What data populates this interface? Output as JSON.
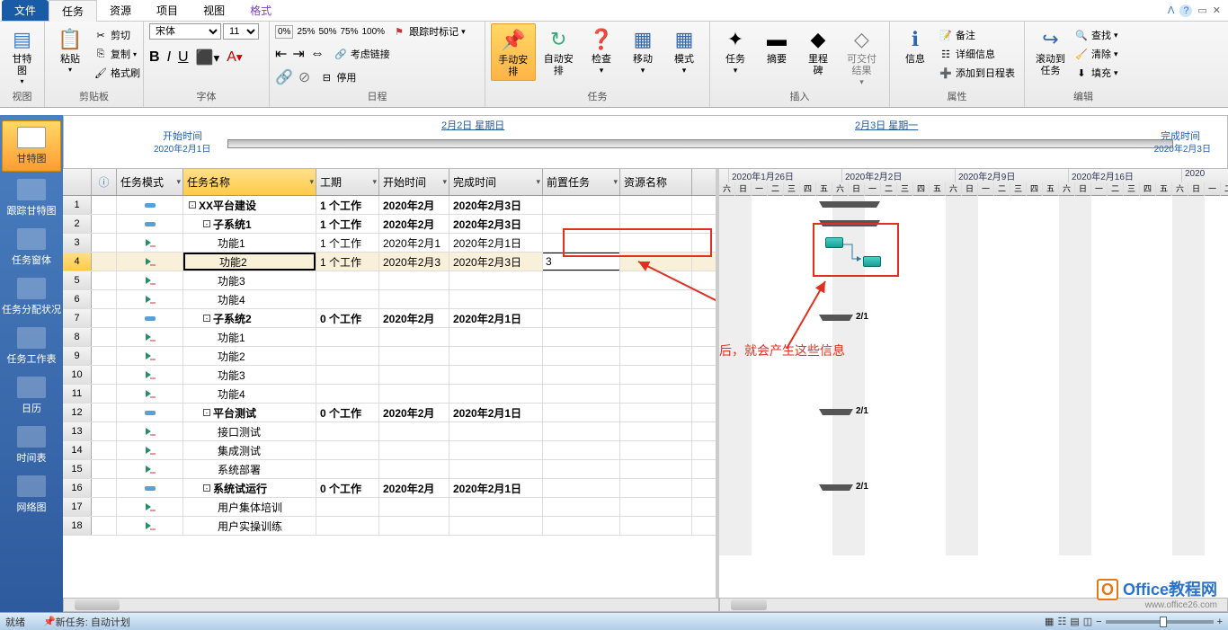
{
  "tabs": [
    "文件",
    "任务",
    "资源",
    "项目",
    "视图",
    "格式"
  ],
  "ribbon": {
    "view_label": "视图",
    "gantt_btn": "甘特图",
    "clipboard_label": "剪贴板",
    "paste": "粘贴",
    "cut": "剪切",
    "copy": "复制",
    "format_painter": "格式刷",
    "font_label": "字体",
    "font_name": "宋体",
    "font_size": "11",
    "schedule_label": "日程",
    "track_mark": "跟踪时标记",
    "respect_links": "考虑链接",
    "disable": "停用",
    "tasks_label": "任务",
    "manual": "手动安排",
    "auto": "自动安排",
    "inspect": "检查",
    "move": "移动",
    "mode": "模式",
    "insert_label": "插入",
    "task_btn": "任务",
    "summary_btn": "摘要",
    "milestone_btn": "里程碑",
    "deliverable_btn": "可交付结果",
    "properties_label": "属性",
    "info_btn": "信息",
    "notes": "备注",
    "details": "详细信息",
    "add_timeline": "添加到日程表",
    "editing_label": "编辑",
    "scrollto": "滚动到\n任务",
    "find": "查找",
    "clear": "清除",
    "fill": "填充"
  },
  "sidebar": [
    "甘特图",
    "跟踪甘特图",
    "任务窗体",
    "任务分配状况",
    "任务工作表",
    "日历",
    "时间表",
    "网络图"
  ],
  "timeline": {
    "start_label": "开始时间",
    "start_date": "2020年2月1日",
    "finish_label": "完成时间",
    "finish_date": "2020年2月3日",
    "top_left": "2月2日  星期日",
    "top_right": "2月3日  星期一"
  },
  "columns": {
    "info": "",
    "mode": "任务模式",
    "name": "任务名称",
    "duration": "工期",
    "start": "开始时间",
    "finish": "完成时间",
    "pred": "前置任务",
    "res": "资源名称"
  },
  "rows": [
    {
      "n": "1",
      "mode": "auto",
      "out": "-",
      "ind": 0,
      "name": "XX平台建设",
      "dur": "1 个工作",
      "start": "2020年2月",
      "finish": "2020年2月3日",
      "pred": "",
      "b": true
    },
    {
      "n": "2",
      "mode": "auto",
      "out": "-",
      "ind": 1,
      "name": "子系统1",
      "dur": "1 个工作",
      "start": "2020年2月",
      "finish": "2020年2月3日",
      "pred": "",
      "b": true
    },
    {
      "n": "3",
      "mode": "man",
      "out": "",
      "ind": 2,
      "name": "功能1",
      "dur": "1 个工作",
      "start": "2020年2月1",
      "finish": "2020年2月1日",
      "pred": "",
      "b": false
    },
    {
      "n": "4",
      "mode": "man",
      "out": "",
      "ind": 2,
      "name": "功能2",
      "dur": "1 个工作",
      "start": "2020年2月3",
      "finish": "2020年2月3日",
      "pred": "3",
      "b": false,
      "sel": true
    },
    {
      "n": "5",
      "mode": "man",
      "out": "",
      "ind": 2,
      "name": "功能3",
      "dur": "",
      "start": "",
      "finish": "",
      "pred": "",
      "b": false
    },
    {
      "n": "6",
      "mode": "man",
      "out": "",
      "ind": 2,
      "name": "功能4",
      "dur": "",
      "start": "",
      "finish": "",
      "pred": "",
      "b": false
    },
    {
      "n": "7",
      "mode": "auto",
      "out": "-",
      "ind": 1,
      "name": "子系统2",
      "dur": "0 个工作",
      "start": "2020年2月",
      "finish": "2020年2月1日",
      "pred": "",
      "b": true
    },
    {
      "n": "8",
      "mode": "man",
      "out": "",
      "ind": 2,
      "name": "功能1",
      "dur": "",
      "start": "",
      "finish": "",
      "pred": "",
      "b": false
    },
    {
      "n": "9",
      "mode": "man",
      "out": "",
      "ind": 2,
      "name": "功能2",
      "dur": "",
      "start": "",
      "finish": "",
      "pred": "",
      "b": false
    },
    {
      "n": "10",
      "mode": "man",
      "out": "",
      "ind": 2,
      "name": "功能3",
      "dur": "",
      "start": "",
      "finish": "",
      "pred": "",
      "b": false
    },
    {
      "n": "11",
      "mode": "man",
      "out": "",
      "ind": 2,
      "name": "功能4",
      "dur": "",
      "start": "",
      "finish": "",
      "pred": "",
      "b": false
    },
    {
      "n": "12",
      "mode": "auto",
      "out": "-",
      "ind": 1,
      "name": "平台测试",
      "dur": "0 个工作",
      "start": "2020年2月",
      "finish": "2020年2月1日",
      "pred": "",
      "b": true
    },
    {
      "n": "13",
      "mode": "man",
      "out": "",
      "ind": 2,
      "name": "接口测试",
      "dur": "",
      "start": "",
      "finish": "",
      "pred": "",
      "b": false
    },
    {
      "n": "14",
      "mode": "man",
      "out": "",
      "ind": 2,
      "name": "集成测试",
      "dur": "",
      "start": "",
      "finish": "",
      "pred": "",
      "b": false
    },
    {
      "n": "15",
      "mode": "man",
      "out": "",
      "ind": 2,
      "name": "系统部署",
      "dur": "",
      "start": "",
      "finish": "",
      "pred": "",
      "b": false
    },
    {
      "n": "16",
      "mode": "auto",
      "out": "-",
      "ind": 1,
      "name": "系统试运行",
      "dur": "0 个工作",
      "start": "2020年2月",
      "finish": "2020年2月1日",
      "pred": "",
      "b": true
    },
    {
      "n": "17",
      "mode": "man",
      "out": "",
      "ind": 2,
      "name": "用户集体培训",
      "dur": "",
      "start": "",
      "finish": "",
      "pred": "",
      "b": false
    },
    {
      "n": "18",
      "mode": "man",
      "out": "",
      "ind": 2,
      "name": "用户实操训练",
      "dur": "",
      "start": "",
      "finish": "",
      "pred": "",
      "b": false
    }
  ],
  "gantt_weeks": [
    "2020年1月26日",
    "2020年2月2日",
    "2020年2月9日",
    "2020年2月16日",
    "2020"
  ],
  "gantt_days": [
    "六",
    "日",
    "一",
    "二",
    "三",
    "四",
    "五"
  ],
  "gantt_summary_label": "2/1",
  "annotation": "设置完依赖后，就会产生这些信息",
  "status": {
    "ready": "就绪",
    "newtask": "新任务: 自动计划"
  },
  "watermark": {
    "text": "Office教程网",
    "url": "www.office26.com"
  }
}
